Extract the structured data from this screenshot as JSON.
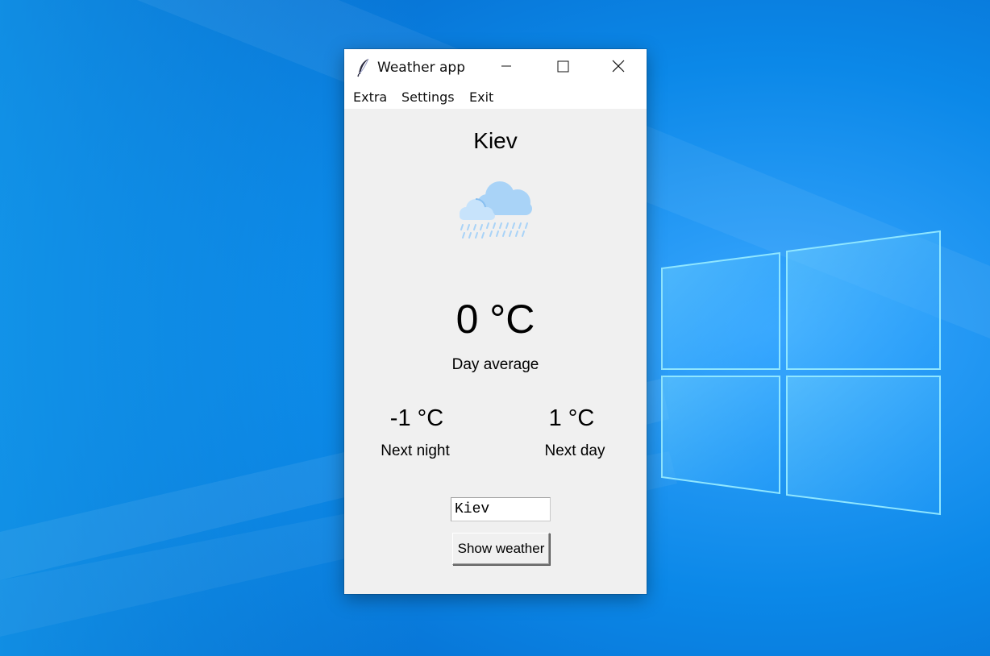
{
  "window": {
    "title": "Weather app",
    "app_icon": "feather-icon",
    "controls": [
      "minimize-icon",
      "maximize-icon",
      "close-icon"
    ]
  },
  "menu": {
    "items": [
      {
        "label": "Extra"
      },
      {
        "label": "Settings"
      },
      {
        "label": "Exit"
      }
    ]
  },
  "weather": {
    "city": "Kiev",
    "condition_icon": "cloud-rain-icon",
    "day_average_temp": "0 °C",
    "day_average_label": "Day average",
    "next_night_temp": "-1 °C",
    "next_night_label": "Next night",
    "next_day_temp": "1 °C",
    "next_day_label": "Next day"
  },
  "search": {
    "value": "Kiev",
    "button_label": "Show weather"
  },
  "colors": {
    "desktop_blue": "#0a7fe0",
    "window_bg": "#f0f0f0",
    "titlebar_bg": "#ffffff",
    "cloud": "#a8d4f8"
  }
}
